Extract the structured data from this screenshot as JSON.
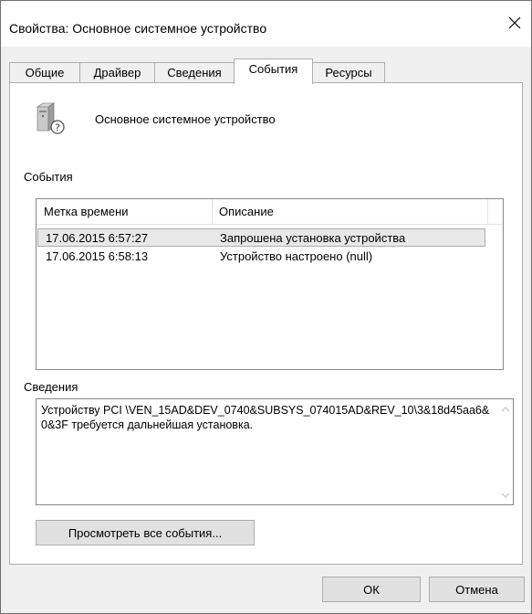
{
  "window": {
    "title": "Свойства: Основное системное устройство",
    "close_icon": "close-icon"
  },
  "tabs": [
    {
      "label": "Общие"
    },
    {
      "label": "Драйвер"
    },
    {
      "label": "Сведения"
    },
    {
      "label": "События",
      "active": true
    },
    {
      "label": "Ресурсы"
    }
  ],
  "device": {
    "name": "Основное системное устройство",
    "icon": "device-unknown-icon"
  },
  "events": {
    "label": "События",
    "columns": [
      "Метка времени",
      "Описание"
    ],
    "rows": [
      {
        "time": "17.06.2015 6:57:27",
        "description": "Запрошена установка устройства",
        "selected": true
      },
      {
        "time": "17.06.2015 6:58:13",
        "description": "Устройство настроено (null)",
        "selected": false
      }
    ]
  },
  "details": {
    "label": "Сведения",
    "text": "Устройству PCI \\VEN_15AD&DEV_0740&SUBSYS_074015AD&REV_10\\3&18d45aa6&0&3F требуется дальнейшая установка."
  },
  "buttons": {
    "view_all": "Просмотреть все события...",
    "ok": "ОК",
    "cancel": "Отмена"
  }
}
